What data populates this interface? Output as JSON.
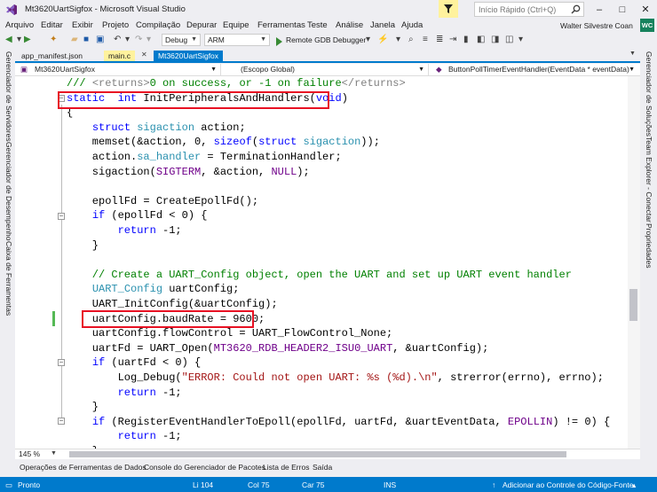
{
  "window": {
    "title": "Mt3620UartSigfox - Microsoft Visual Studio",
    "quick_launch_placeholder": "Início Rápido (Ctrl+Q)"
  },
  "menu": [
    "Arquivo",
    "Editar",
    "Exibir",
    "Projeto",
    "Compilação",
    "Depurar",
    "Equipe",
    "Ferramentas",
    "Teste",
    "Análise",
    "Janela",
    "Ajuda"
  ],
  "user": {
    "name": "Walter Silvestre Coan",
    "initials": "WC"
  },
  "toolbar": {
    "config": "Debug",
    "platform": "ARM",
    "run_label": "Remote GDB Debugger"
  },
  "left_panels": [
    "Gerenciador de Servidores",
    "Gerenciador de Desempenho",
    "Caixa de Ferramentas"
  ],
  "right_panels": [
    "Gerenciador de Soluções",
    "Team Explorer - Conectar",
    "Propriedades"
  ],
  "doc_tabs": [
    {
      "label": "app_manifest.json",
      "state": "normal"
    },
    {
      "label": "main.c",
      "state": "active"
    },
    {
      "label": "Mt3620UartSigfox",
      "state": "highlight"
    }
  ],
  "nav": {
    "project": "Mt3620UartSigfox",
    "scope": "(Escopo Global)",
    "member": "ButtonPollTimerEventHandler(EventData * eventData)"
  },
  "code": [
    {
      "parts": [
        [
          "cm",
          "/// "
        ],
        [
          "xd",
          "<returns>"
        ],
        [
          "cm",
          "0 on success, or -1 on failure"
        ],
        [
          "xd",
          "</returns>"
        ]
      ]
    },
    {
      "parts": [
        [
          "kw",
          "static"
        ],
        [
          "",
          "  "
        ],
        [
          "kw",
          "int"
        ],
        [
          "",
          " InitPeripheralsAndHandlers("
        ],
        [
          "kw",
          "void"
        ],
        [
          "",
          ")"
        ]
      ]
    },
    {
      "parts": [
        [
          "",
          "{"
        ]
      ]
    },
    {
      "parts": [
        [
          "",
          "    "
        ],
        [
          "kw",
          "struct"
        ],
        [
          "",
          " "
        ],
        [
          "ty",
          "sigaction"
        ],
        [
          "",
          " action;"
        ]
      ]
    },
    {
      "parts": [
        [
          "",
          "    memset(&action, 0, "
        ],
        [
          "kw",
          "sizeof"
        ],
        [
          "",
          "("
        ],
        [
          "kw",
          "struct"
        ],
        [
          "",
          " "
        ],
        [
          "ty",
          "sigaction"
        ],
        [
          "",
          "));"
        ]
      ]
    },
    {
      "parts": [
        [
          "",
          "    action."
        ],
        [
          "ty",
          "sa_handler"
        ],
        [
          "",
          " = TerminationHandler;"
        ]
      ]
    },
    {
      "parts": [
        [
          "",
          "    sigaction("
        ],
        [
          "mc",
          "SIGTERM"
        ],
        [
          "",
          ", &action, "
        ],
        [
          "mc",
          "NULL"
        ],
        [
          "",
          ");"
        ]
      ]
    },
    {
      "parts": [
        [
          "",
          ""
        ]
      ]
    },
    {
      "parts": [
        [
          "",
          "    epollFd = CreateEpollFd();"
        ]
      ]
    },
    {
      "parts": [
        [
          "",
          "    "
        ],
        [
          "kw",
          "if"
        ],
        [
          "",
          " (epollFd < 0) {"
        ]
      ]
    },
    {
      "parts": [
        [
          "",
          "        "
        ],
        [
          "kw",
          "return"
        ],
        [
          "",
          " -1;"
        ]
      ]
    },
    {
      "parts": [
        [
          "",
          "    }"
        ]
      ]
    },
    {
      "parts": [
        [
          "",
          ""
        ]
      ]
    },
    {
      "parts": [
        [
          "cm",
          "    // Create a UART_Config object, open the UART and set up UART event handler"
        ]
      ]
    },
    {
      "parts": [
        [
          "",
          "    "
        ],
        [
          "ty",
          "UART_Config"
        ],
        [
          "",
          " uartConfig;"
        ]
      ]
    },
    {
      "parts": [
        [
          "",
          "    UART_InitConfig(&uartConfig);"
        ]
      ]
    },
    {
      "parts": [
        [
          "",
          "    uartConfig.baudRate = 9600;"
        ]
      ]
    },
    {
      "parts": [
        [
          "",
          "    uartConfig.flowControl = UART_FlowControl_None;"
        ]
      ]
    },
    {
      "parts": [
        [
          "",
          "    uartFd = UART_Open("
        ],
        [
          "mc",
          "MT3620_RDB_HEADER2_ISU0_UART"
        ],
        [
          "",
          ", &uartConfig);"
        ]
      ]
    },
    {
      "parts": [
        [
          "",
          "    "
        ],
        [
          "kw",
          "if"
        ],
        [
          "",
          " (uartFd < 0) {"
        ]
      ]
    },
    {
      "parts": [
        [
          "",
          "        Log_Debug("
        ],
        [
          "st",
          "\"ERROR: Could not open UART: %s (%d).\\n\""
        ],
        [
          "",
          ", strerror(errno), errno);"
        ]
      ]
    },
    {
      "parts": [
        [
          "",
          "        "
        ],
        [
          "kw",
          "return"
        ],
        [
          "",
          " -1;"
        ]
      ]
    },
    {
      "parts": [
        [
          "",
          "    }"
        ]
      ]
    },
    {
      "parts": [
        [
          "",
          "    "
        ],
        [
          "kw",
          "if"
        ],
        [
          "",
          " (RegisterEventHandlerToEpoll(epollFd, uartFd, &uartEventData, "
        ],
        [
          "mc",
          "EPOLLIN"
        ],
        [
          "",
          ") != 0) {"
        ]
      ]
    },
    {
      "parts": [
        [
          "",
          "        "
        ],
        [
          "kw",
          "return"
        ],
        [
          "",
          " -1;"
        ]
      ]
    },
    {
      "parts": [
        [
          "",
          "    }"
        ]
      ]
    }
  ],
  "zoom": "145 %",
  "bottom_tabs": [
    "Operações de Ferramentas de Dados",
    "Console do Gerenciador de Pacotes",
    "Lista de Erros",
    "Saída"
  ],
  "status": {
    "state": "Pronto",
    "line": "Li 104",
    "col": "Col 75",
    "char": "Car 75",
    "ins": "INS",
    "source_control": "Adicionar ao Controle do Código-Fonte"
  },
  "colors": {
    "accent": "#007acc",
    "highlight_box": "#e81123",
    "avatar": "#16825d"
  }
}
